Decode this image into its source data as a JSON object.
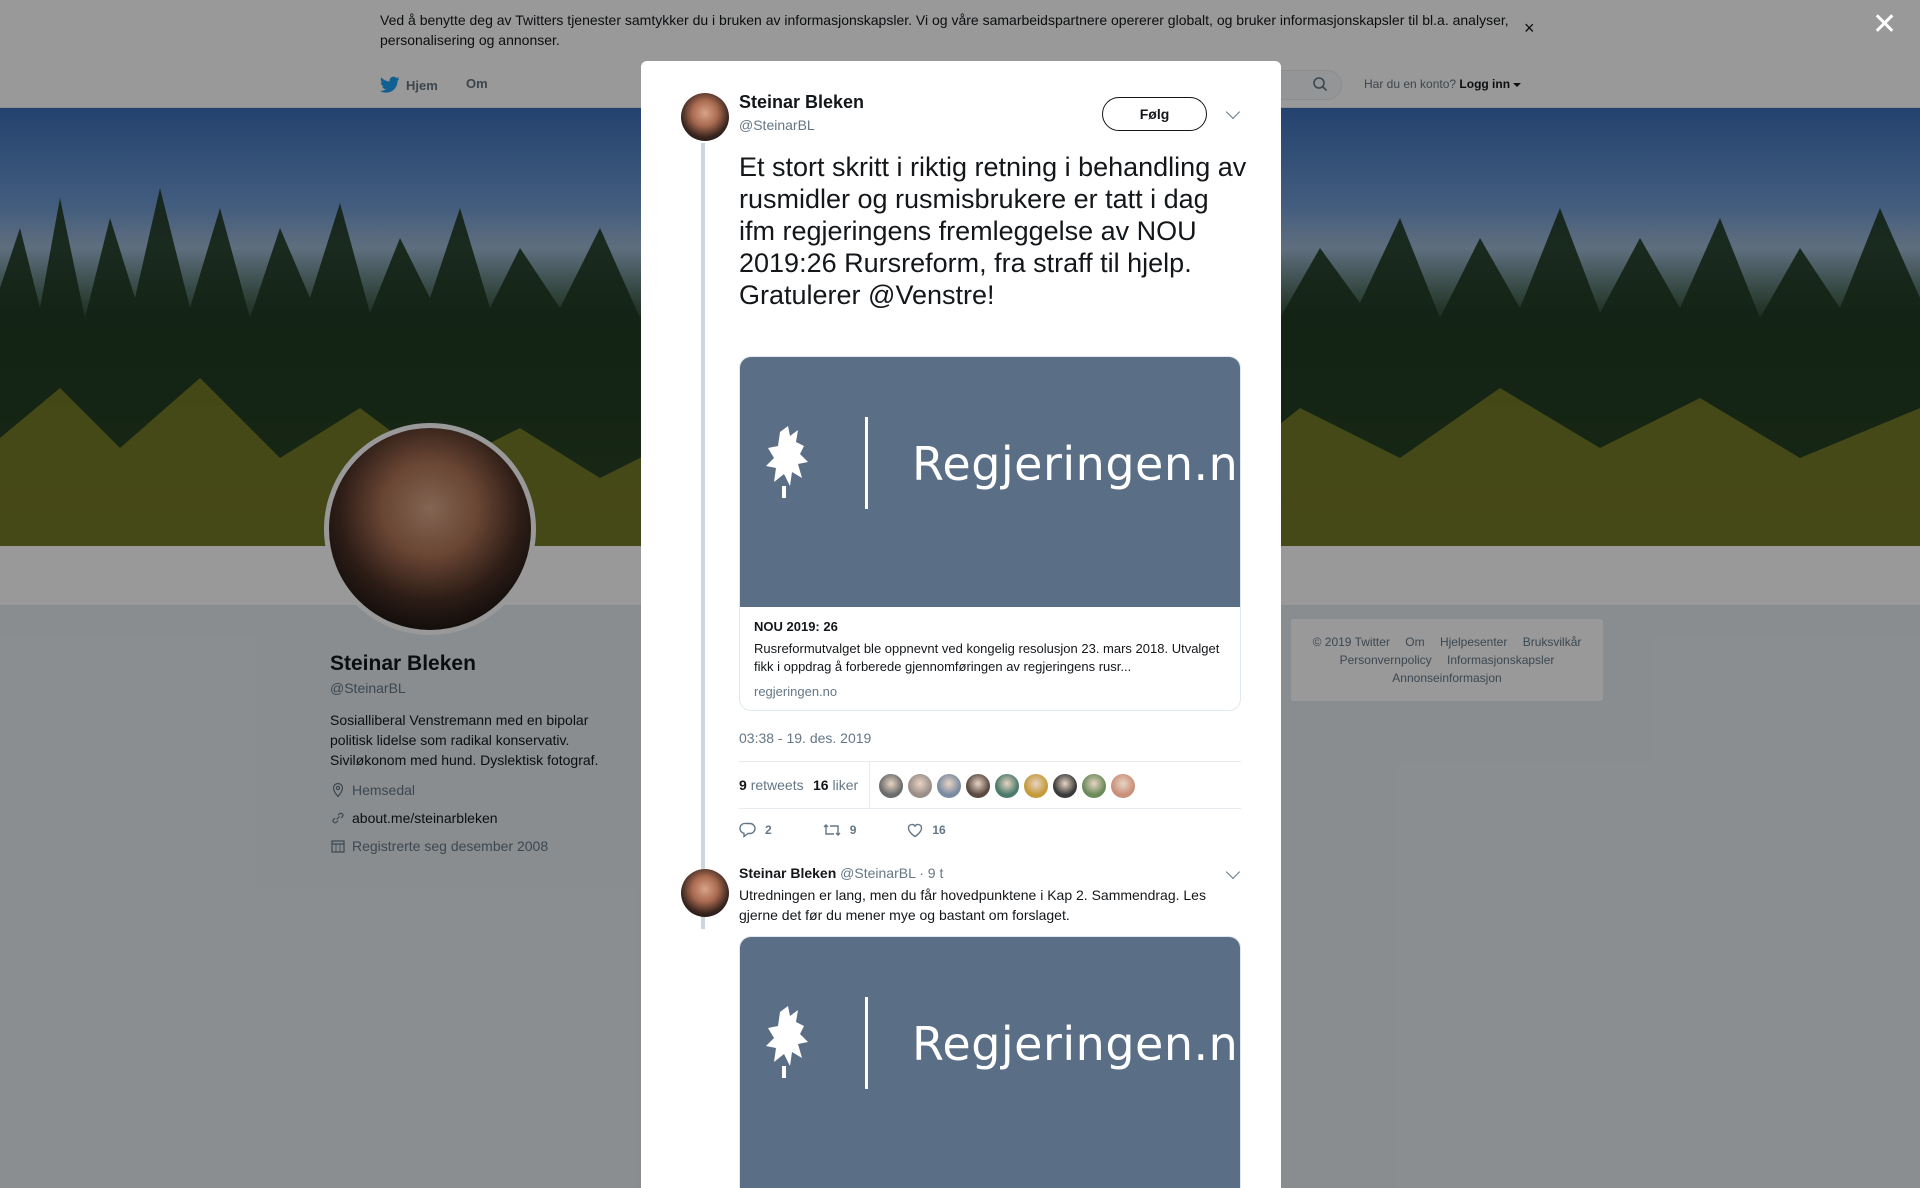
{
  "cookie": {
    "text_before": "Ved å benytte deg av Twitters tjenester samtykker du i bruken av ",
    "link": "informasjonskapsler",
    "text_after": ". Vi og våre samarbeidspartnere opererer globalt, og bruker informasjonskapsler til bl.a. analyser, personalisering og annonser.",
    "close": "×"
  },
  "nav": {
    "home": "Hjem",
    "about": "Om",
    "account_prompt": "Har du en konto?",
    "login": "Logg inn"
  },
  "profile": {
    "name": "Steinar Bleken",
    "handle": "@SteinarBL",
    "bio": "Sosialliberal Venstremann med en bipolar politisk lidelse som radikal konservativ. Siviløkonom med hund. Dyslektisk fotograf.",
    "location": "Hemsedal",
    "url": "about.me/steinarbleken",
    "joined": "Registrerte seg desember 2008"
  },
  "footer": {
    "items": [
      "© 2019 Twitter",
      "Om",
      "Hjelpesenter",
      "Bruksvilkår",
      "Personvernpolicy",
      "Informasjonskapsler",
      "Annonseinformasjon"
    ]
  },
  "overlay_close": "✕",
  "tweet": {
    "name": "Steinar Bleken",
    "handle": "@SteinarBL",
    "follow": "Følg",
    "text_line1": "Et stort skritt i riktig retning i behandling av rusmidler og rusmisbrukere er tatt i dag ifm regjeringens fremleggelse av NOU 2019:26 Rursreform, fra straff til hjelp.",
    "text_line2": "Gratulerer @Venstre!",
    "card": {
      "logo_text": "Regjeringen.no",
      "title": "NOU 2019: 26",
      "description": "Rusreformutvalget ble oppnevnt ved kongelig resolusjon 23. mars 2018. Utvalget fikk i oppdrag å forberede gjennomføringen av regjeringens rusr...",
      "domain": "regjeringen.no"
    },
    "time": "03:38 - 19. des. 2019",
    "retweets_count": "9",
    "retweets_label": "retweets",
    "likes_count": "16",
    "likes_label": "liker",
    "replies": "2",
    "retweet_action": "9",
    "like_action": "16",
    "liker_colors": [
      "#6b6b6b",
      "#9a8f88",
      "#7a8aa0",
      "#5a4a40",
      "#4a7a6a",
      "#c49a3a",
      "#3a3a3a",
      "#6a8a5a",
      "#c9907a"
    ]
  },
  "reply": {
    "name": "Steinar Bleken",
    "handle": "@SteinarBL",
    "time": "· 9 t",
    "text": "Utredningen er lang, men du får hovedpunktene i Kap 2. Sammendrag. Les gjerne det før du mener mye og bastant om forslaget.",
    "card_logo_text": "Regjeringen.no"
  }
}
